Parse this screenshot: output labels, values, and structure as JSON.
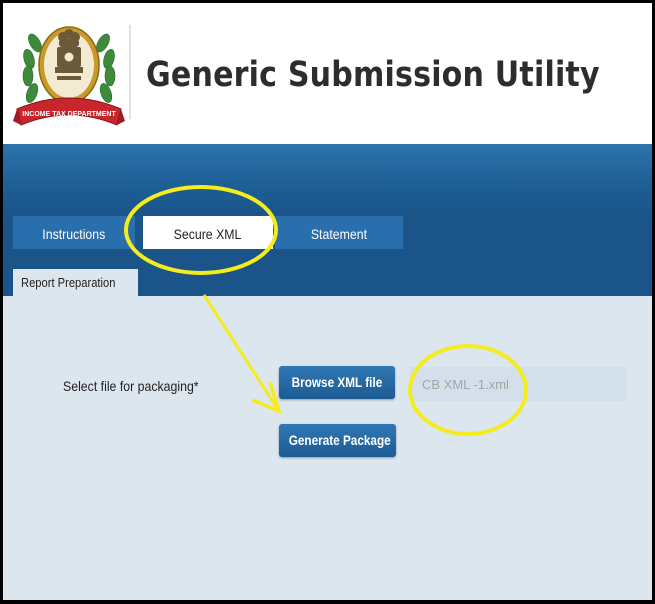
{
  "header": {
    "logo": {
      "icon": "income-tax-department-emblem-icon",
      "ribbon_text": "INCOME TAX DEPARTMENT",
      "emblem_text": "सत्यमेव जयते"
    },
    "title": "Generic Submission Utility"
  },
  "tabs": [
    {
      "label": "Instructions",
      "active": false
    },
    {
      "label": "Secure XML",
      "active": true
    },
    {
      "label": "Statement",
      "active": false
    }
  ],
  "subtabs": [
    {
      "label": "Report Preparation",
      "active": true
    }
  ],
  "form": {
    "field_label": "Select file for packaging*",
    "browse_button": "Browse XML file",
    "file_value": "CB XML -1.xml",
    "generate_button": "Generate Package"
  },
  "annotations": {
    "highlight_color": "#f5ec1f",
    "items": [
      "ellipse-around-secure-xml-tab",
      "arrow-to-generate-package",
      "ellipse-around-file-name"
    ]
  },
  "colors": {
    "primary_blue": "#1d5e94",
    "tab_blue": "#2a6fad",
    "content_bg": "#dce6ef",
    "title_text": "#2d2d2d"
  }
}
